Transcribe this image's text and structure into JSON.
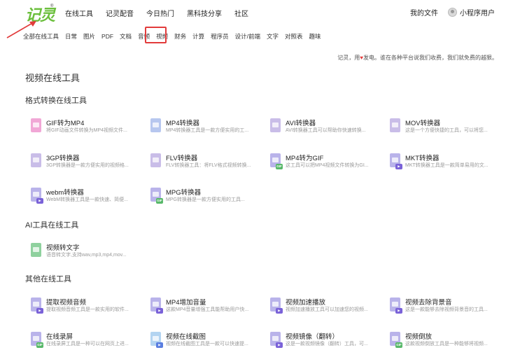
{
  "brand": {
    "logo_text": "记灵",
    "reg_mark": "®"
  },
  "topnav": [
    "在线工具",
    "记灵配音",
    "今日热门",
    "黑科技分享",
    "社区"
  ],
  "header_right": {
    "files": "我的文件",
    "user": "小程序用户"
  },
  "categories": [
    "全部在线工具",
    "日常",
    "图片",
    "PDF",
    "文档",
    "音频",
    "视频",
    "财务",
    "计算",
    "程序员",
    "设计/前端",
    "文字",
    "对照表",
    "趣味"
  ],
  "active_category": "视频",
  "slogan": {
    "before": "记灵，用",
    "heart": "♥",
    "after": "发电。谁在各种平台说我们收费，我们就免费的越狠。"
  },
  "page_title": "视频在线工具",
  "sections": [
    {
      "title": "格式转换在线工具",
      "tools": [
        {
          "name": "GIF转为MP4",
          "desc": "将GIF动画文件转换为MP4视频文件...",
          "icon": "pink"
        },
        {
          "name": "MP4转换器",
          "desc": "MP4转换器工具是一款方便实用的工...",
          "icon": "blue"
        },
        {
          "name": "AVI转换器",
          "desc": "AVI转换器工具可以帮助你快速转换...",
          "icon": "violet"
        },
        {
          "name": "MOV转换器",
          "desc": "这是一个方便快捷的工具，可以将您...",
          "icon": "violet"
        },
        {
          "name": "3GP转换器",
          "desc": "3GP转换器是一款方便实用的视频格...",
          "icon": "violet"
        },
        {
          "name": "FLV转换器",
          "desc": "FLV转换器工具：将FLV格式视频转换...",
          "icon": "violet"
        },
        {
          "name": "MP4转为GIF",
          "desc": "这工具可以把MP4视频文件转换为GI...",
          "icon": "lav"
        },
        {
          "name": "MKT转换器",
          "desc": "MKT转换器工具是一款简单易用的文...",
          "icon": "lav"
        },
        {
          "name": "webm转换器",
          "desc": "WebM转换器工具是一款快速、简便...",
          "icon": "lav"
        },
        {
          "name": "MPG转换器",
          "desc": "MPG转换器是一款方便实用的工具...",
          "icon": "lav"
        }
      ]
    },
    {
      "title": "AI工具在线工具",
      "tools": [
        {
          "name": "视频转文字",
          "desc": "语音转文字,支持wav,mp3,mp4,mov...",
          "icon": "green"
        }
      ]
    },
    {
      "title": "其他在线工具",
      "tools": [
        {
          "name": "提取视频音频",
          "desc": "提取视频音频工具是一款实用的软件...",
          "icon": "lav"
        },
        {
          "name": "MP4增加音量",
          "desc": "这款MP4音量增强工具能帮助用户快...",
          "icon": "lav"
        },
        {
          "name": "视频加速播放",
          "desc": "视频加速播放工具可以加速您的视频...",
          "icon": "lav"
        },
        {
          "name": "视频去除背景音",
          "desc": "这是一款能够去除视频背景音的工具...",
          "icon": "lav"
        },
        {
          "name": "在线录屏",
          "desc": "在线录屏工具是一种可以在网页上进...",
          "icon": "lav"
        },
        {
          "name": "视频在线截图",
          "desc": "视频在线截图工具是一款可以快速提...",
          "icon": "lightblue"
        },
        {
          "name": "视频镜像（翻转）",
          "desc": "这是一款视频镜像（翻转）工具，可...",
          "icon": "lav"
        },
        {
          "name": "视频倒放",
          "desc": "这款视频倒放工具是一种能够将视频...",
          "icon": "lav"
        }
      ]
    }
  ],
  "colors": {
    "brand_green": "#6bbf3c",
    "highlight_red": "#e23b3b",
    "heart_red": "#e23b3b"
  }
}
